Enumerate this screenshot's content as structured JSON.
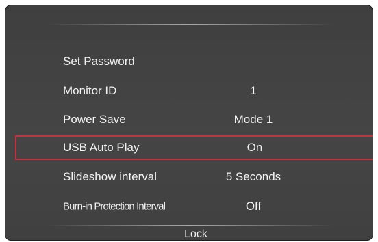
{
  "menu": {
    "items": [
      {
        "label": "Set Password",
        "value": ""
      },
      {
        "label": "Monitor ID",
        "value": "1"
      },
      {
        "label": "Power Save",
        "value": "Mode 1"
      },
      {
        "label": "USB Auto Play",
        "value": "On"
      },
      {
        "label": "Slideshow interval",
        "value": "5 Seconds"
      },
      {
        "label": "Burn-in Protection Interval",
        "value": "Off"
      }
    ],
    "selected_index": 3,
    "selection_color": "#c8313a"
  },
  "footer": {
    "label": "Lock"
  }
}
